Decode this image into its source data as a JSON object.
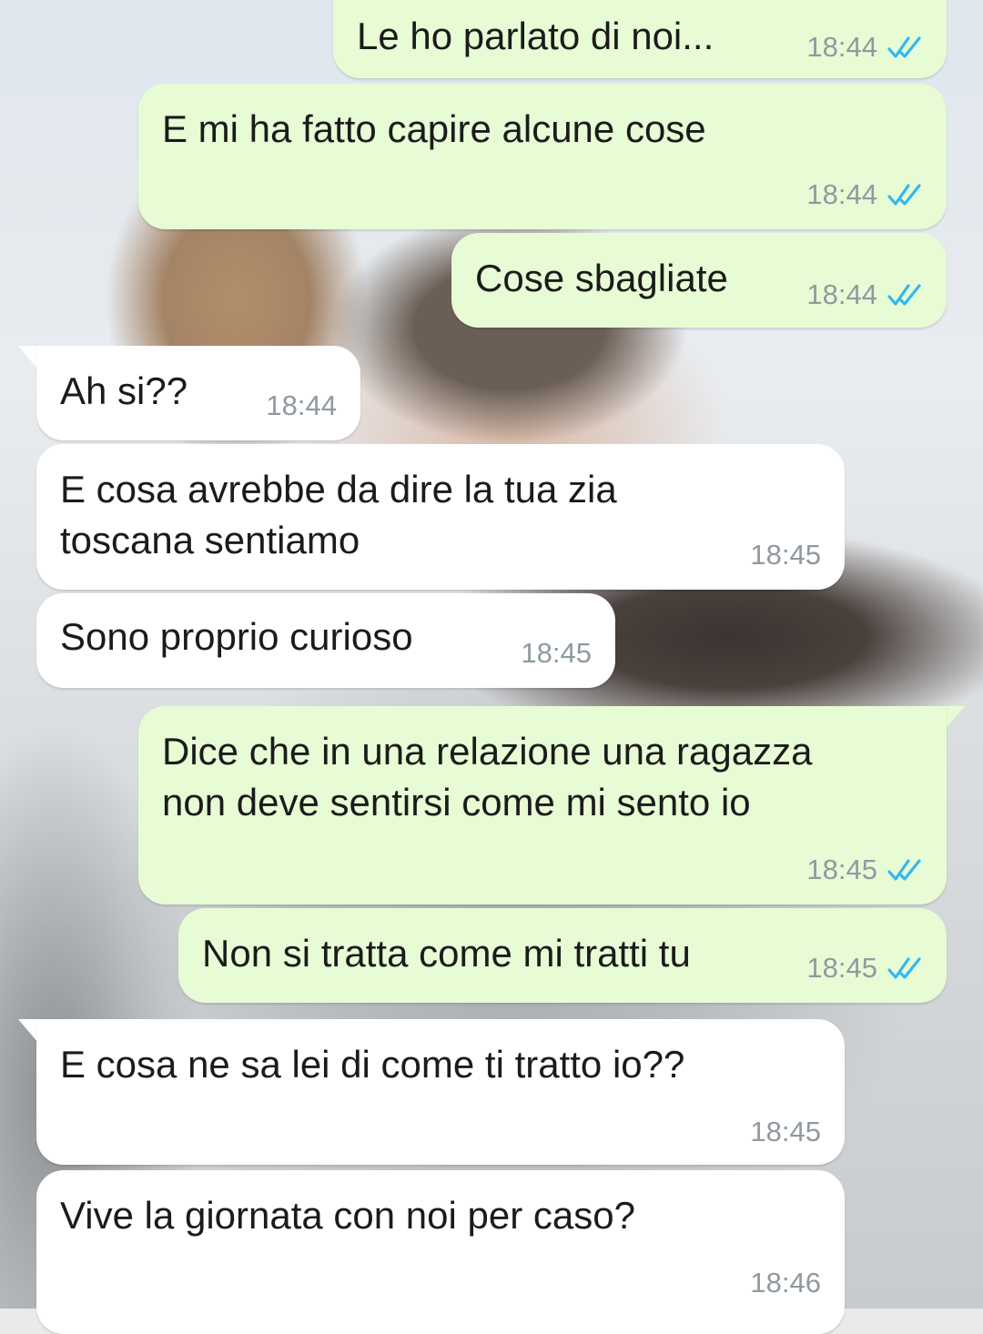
{
  "colors": {
    "outgoing_bubble": "#e7fcd5",
    "incoming_bubble": "#ffffff",
    "read_ticks": "#34b7f1",
    "timestamp": "#8e9aa0"
  },
  "messages": [
    {
      "direction": "outgoing",
      "text": "Le ho parlato di noi...",
      "time": "18:44",
      "status_icon": "double-check-read-icon"
    },
    {
      "direction": "outgoing",
      "text": "E mi ha fatto capire alcune cose",
      "time": "18:44",
      "status_icon": "double-check-read-icon"
    },
    {
      "direction": "outgoing",
      "text": "Cose sbagliate",
      "time": "18:44",
      "status_icon": "double-check-read-icon"
    },
    {
      "direction": "incoming",
      "text": "Ah si??",
      "time": "18:44"
    },
    {
      "direction": "incoming",
      "text_line1": "E cosa avrebbe da dire la tua zia",
      "text_line2": "toscana sentiamo",
      "time": "18:45"
    },
    {
      "direction": "incoming",
      "text": "Sono proprio curioso",
      "time": "18:45"
    },
    {
      "direction": "outgoing",
      "text_line1": "Dice che in una relazione una ragazza",
      "text_line2": "non deve sentirsi come mi sento io",
      "time": "18:45",
      "status_icon": "double-check-read-icon"
    },
    {
      "direction": "outgoing",
      "text": "Non si tratta come mi tratti tu",
      "time": "18:45",
      "status_icon": "double-check-read-icon"
    },
    {
      "direction": "incoming",
      "text": "E cosa ne sa lei di come ti tratto io??",
      "time": "18:45"
    },
    {
      "direction": "incoming",
      "text": "Vive la giornata con noi per caso?",
      "time": "18:46"
    }
  ]
}
